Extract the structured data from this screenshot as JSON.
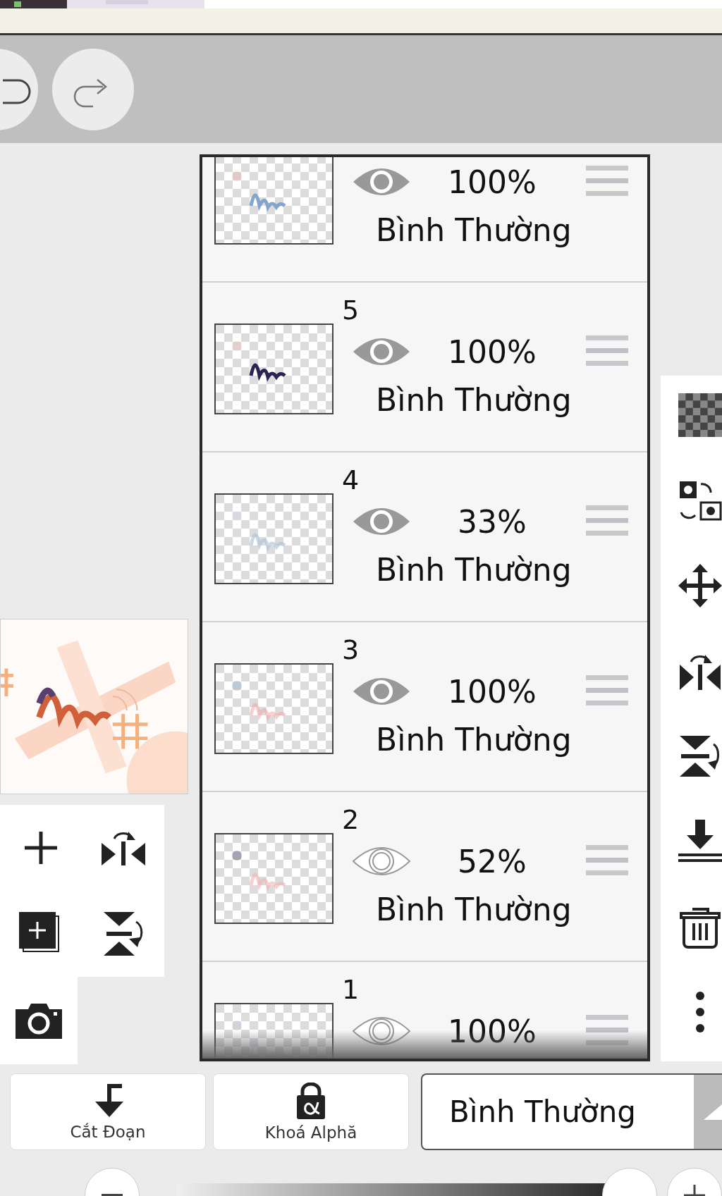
{
  "layers": [
    {
      "opacity": "100%",
      "blend": "Bình Thường",
      "visible": true
    },
    {
      "number": "5",
      "opacity": "100%",
      "blend": "Bình Thường",
      "visible": true
    },
    {
      "number": "4",
      "opacity": "33%",
      "blend": "Bình Thường",
      "visible": true
    },
    {
      "number": "3",
      "opacity": "100%",
      "blend": "Bình Thường",
      "visible": true
    },
    {
      "number": "2",
      "opacity": "52%",
      "blend": "Bình Thường",
      "visible": false
    },
    {
      "number": "1",
      "opacity": "100%",
      "visible": false
    }
  ],
  "bottom_bar": {
    "clipping_button": "Cắt Đoạn",
    "alpha_lock_button": "Khoá Alphă",
    "blend_mode": "Bình Thường"
  },
  "opacity_slider": {
    "level": 1
  }
}
